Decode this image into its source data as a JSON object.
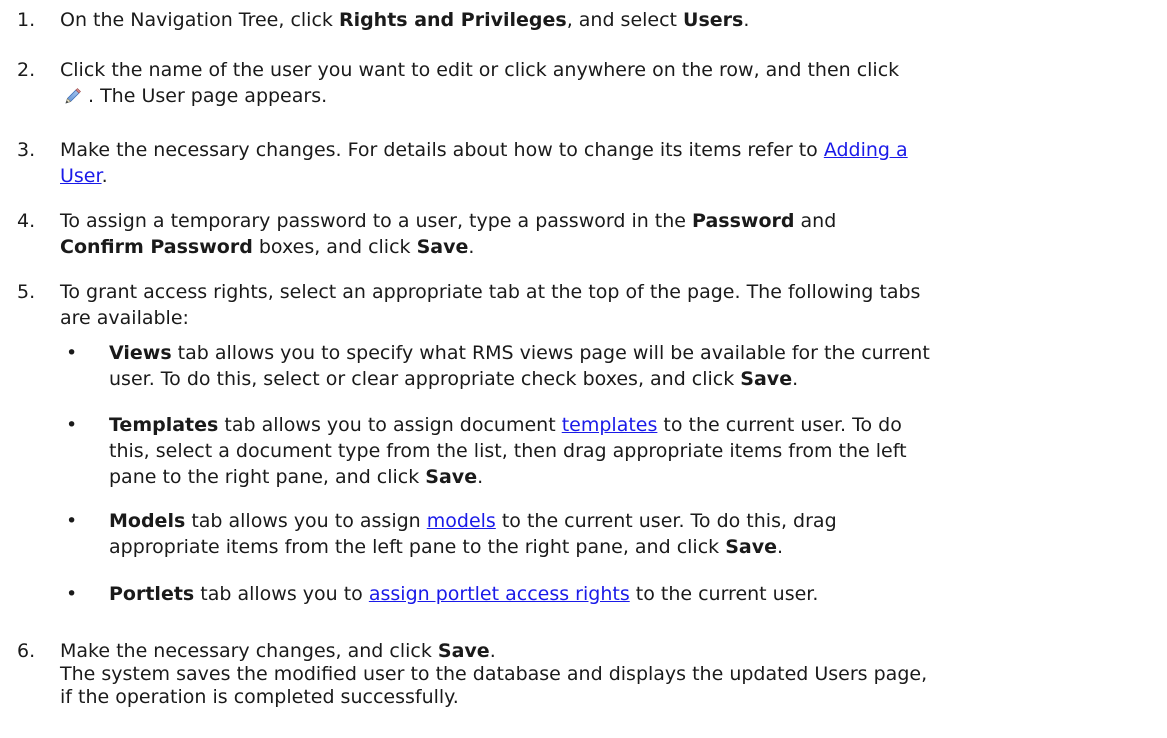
{
  "steps": [
    {
      "num": "1.",
      "t1": "On the Navigation Tree, click ",
      "b1": "Rights and Privileges",
      "t2": ", and select ",
      "b2": "Users",
      "t3": "."
    },
    {
      "num": "2.",
      "line1": "Click the name of the user you want to edit or click anywhere on the row, and then click",
      "icon": "edit-pencil-icon",
      "line2": ". The User page appears."
    },
    {
      "num": "3.",
      "t1": "Make the necessary changes. For details about how to change its items refer to ",
      "link1": "Adding a",
      "link2": "User",
      "t2": "."
    },
    {
      "num": "4.",
      "t1": "To assign a temporary password to a user, type a password in the ",
      "b1": "Password",
      "t2": " and",
      "b2": "Confirm Password",
      "t3": " boxes, and click ",
      "b3": "Save",
      "t4": "."
    },
    {
      "num": "5.",
      "line1": "To grant access rights, select an appropriate tab at the top of the page. The following tabs",
      "line2": "are available:"
    },
    {
      "num": "6.",
      "t1": "Make the necessary changes, and click ",
      "b1": "Save",
      "t2": ".",
      "line2": "The system saves the modified user to the database and displays the updated Users page,",
      "line3": "if the operation is completed successfully."
    }
  ],
  "bullets": [
    {
      "dot": "•",
      "b1": "Views",
      "line1": " tab allows you to specify what RMS views page will be available for the current",
      "line2": "user. To do this, select or clear appropriate check boxes, and click ",
      "b2": "Save",
      "t3": "."
    },
    {
      "dot": "•",
      "b1": "Templates",
      "t1": " tab allows you to assign document ",
      "link": "templates",
      "t2": " to the current user. To do",
      "line2": "this, select a document type from the list, then drag appropriate items from the left",
      "line3": "pane to the right pane, and click ",
      "b2": "Save",
      "t3": "."
    },
    {
      "dot": "•",
      "b1": "Models",
      "t1": " tab allows you to assign ",
      "link": "models",
      "t2": " to the current user. To do this, drag",
      "line2": "appropriate items from the left pane to the right pane, and click ",
      "b2": "Save",
      "t3": "."
    },
    {
      "dot": "•",
      "b1": "Portlets",
      "t1": " tab allows you to ",
      "link": "assign portlet access rights",
      "t2": " to the current user."
    }
  ]
}
